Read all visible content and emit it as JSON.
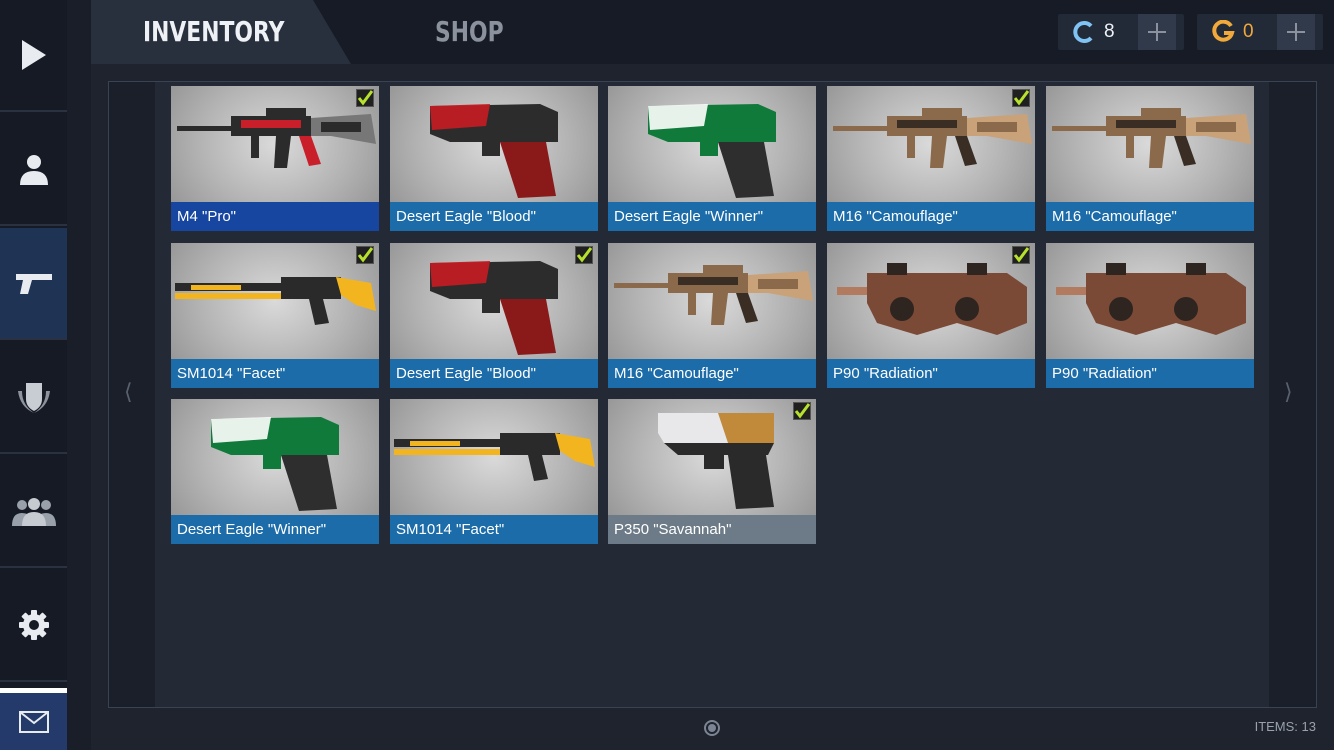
{
  "tabs": {
    "inventory": "INVENTORY",
    "shop": "SHOP"
  },
  "currency": {
    "credits": "8",
    "gold": "0"
  },
  "sidebar": {
    "items": [
      "play-icon",
      "profile-icon",
      "weapons-icon",
      "rank-icon",
      "clan-icon",
      "settings-icon",
      "mail-icon"
    ],
    "active": "weapons-icon"
  },
  "items": [
    {
      "name": "M4 \"Pro\"",
      "equipped": true,
      "type": "rifle",
      "skin": "pro",
      "label_color": "#1746a0"
    },
    {
      "name": "Desert Eagle \"Blood\"",
      "equipped": false,
      "type": "pistol",
      "skin": "blood",
      "label_color": "#1b6ca9"
    },
    {
      "name": "Desert Eagle \"Winner\"",
      "equipped": false,
      "type": "pistol",
      "skin": "winner",
      "label_color": "#1b6ca9"
    },
    {
      "name": "M16 \"Camouflage\"",
      "equipped": true,
      "type": "rifle",
      "skin": "camo",
      "label_color": "#1b6ca9"
    },
    {
      "name": "M16 \"Camouflage\"",
      "equipped": false,
      "type": "rifle",
      "skin": "camo",
      "label_color": "#1b6ca9"
    },
    {
      "name": "SM1014 \"Facet\"",
      "equipped": true,
      "type": "shotgun",
      "skin": "facet",
      "label_color": "#1b6ca9"
    },
    {
      "name": "Desert Eagle \"Blood\"",
      "equipped": true,
      "type": "pistol",
      "skin": "blood",
      "label_color": "#1b6ca9"
    },
    {
      "name": "M16 \"Camouflage\"",
      "equipped": false,
      "type": "rifle",
      "skin": "camo",
      "label_color": "#1b6ca9"
    },
    {
      "name": "P90 \"Radiation\"",
      "equipped": true,
      "type": "smg",
      "skin": "radiation",
      "label_color": "#1b6ca9"
    },
    {
      "name": "P90 \"Radiation\"",
      "equipped": false,
      "type": "smg",
      "skin": "radiation",
      "label_color": "#1b6ca9"
    },
    {
      "name": "Desert Eagle \"Winner\"",
      "equipped": false,
      "type": "pistol",
      "skin": "winner",
      "label_color": "#1b6ca9"
    },
    {
      "name": "SM1014 \"Facet\"",
      "equipped": false,
      "type": "shotgun",
      "skin": "facet",
      "label_color": "#1b6ca9"
    },
    {
      "name": "P350 \"Savannah\"",
      "equipped": true,
      "type": "compact-pistol",
      "skin": "savannah",
      "label_color": "#6c7b87"
    }
  ],
  "footer": {
    "items_count": "ITEMS: 13"
  },
  "colors": {
    "accent": "#1b6ca9",
    "active_tab": "#29303d",
    "check": "#b6e22e"
  }
}
